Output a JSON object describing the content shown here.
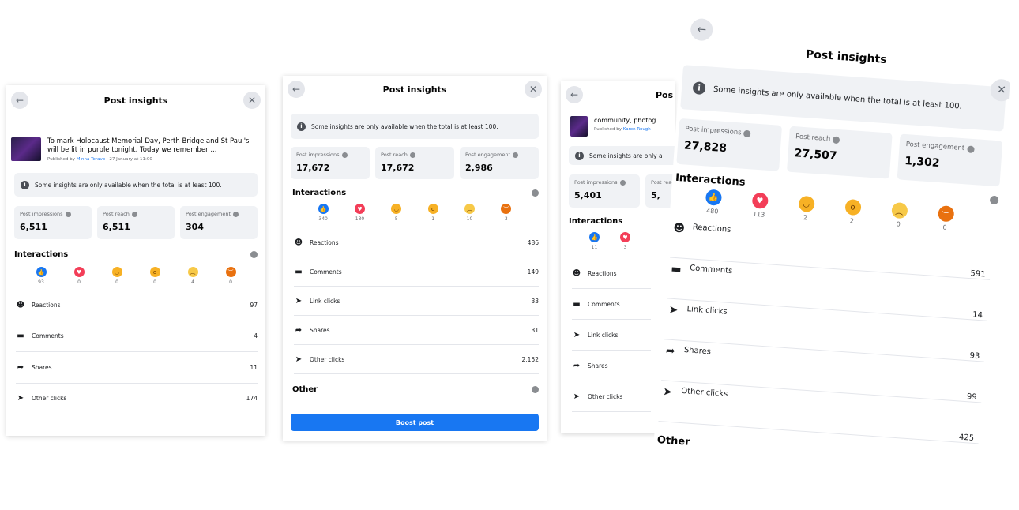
{
  "common": {
    "title": "Post insights",
    "notice": "Some insights are only available when the total is at least 100.",
    "impressions_label": "Post impressions",
    "reach_label": "Post reach",
    "engagement_label": "Post engagement",
    "interactions_label": "Interactions",
    "other_label": "Other",
    "reactions_label": "Reactions",
    "comments_label": "Comments",
    "link_clicks_label": "Link clicks",
    "shares_label": "Shares",
    "other_clicks_label": "Other clicks",
    "icons": {
      "back": "arrow-left-icon",
      "close": "close-icon",
      "info": "info-icon"
    }
  },
  "panel1": {
    "post_text": "To mark Holocaust Memorial Day, Perth Bridge and St Paul's will be lit in purple tonight. Today we remember ...",
    "published_by": "Published by",
    "author": "Minna Teravo",
    "date": "· 27 January at 11:00 ·",
    "impressions": "6,511",
    "reach": "6,511",
    "engagement": "304",
    "reaction_counts": [
      "93",
      "0",
      "0",
      "0",
      "4",
      "0"
    ],
    "reactions": "97",
    "comments": "4",
    "shares": "11",
    "other_clicks": "174"
  },
  "panel2": {
    "impressions": "17,672",
    "reach": "17,672",
    "engagement": "2,986",
    "reaction_counts": [
      "340",
      "130",
      "5",
      "1",
      "10",
      "3"
    ],
    "reactions": "486",
    "comments": "149",
    "link_clicks": "33",
    "shares": "31",
    "other_clicks": "2,152",
    "boost_label": "Boost post"
  },
  "panel3": {
    "title_partial": "Pos",
    "post_text": "community, photog",
    "published_by": "Published by",
    "author": "Karen Rough",
    "notice_partial": "Some insights are only a",
    "impressions": "5,401",
    "reach_partial": "5,",
    "reaction_counts": [
      "11",
      "3"
    ]
  },
  "panel4": {
    "impressions": "27,828",
    "reach": "27,507",
    "engagement": "1,302",
    "reaction_counts": [
      "480",
      "113",
      "2",
      "2",
      "0",
      "0"
    ],
    "reactions": "591",
    "comments": "14",
    "link_clicks": "93",
    "shares": "99",
    "other_clicks": "425"
  }
}
